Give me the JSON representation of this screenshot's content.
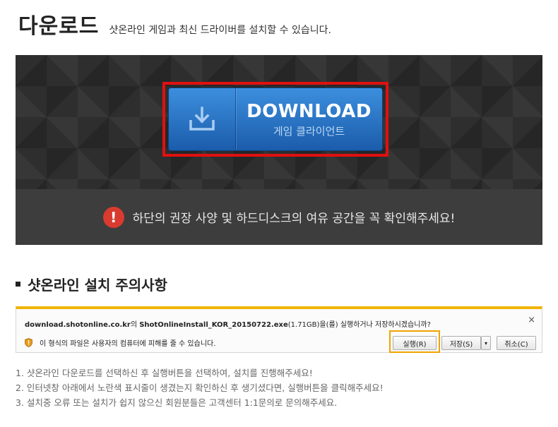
{
  "header": {
    "title": "다운로드",
    "subtitle": "샷온라인 게임과 최신 드라이버를 설치할 수 있습니다."
  },
  "download": {
    "label": "DOWNLOAD",
    "sublabel": "게임 클라이언트",
    "icon": "download-icon",
    "highlight_color": "#e01010",
    "button_color": "#2f7fd0"
  },
  "notice": {
    "icon": "exclamation-icon",
    "text": "하단의 권장 사양 및 하드디스크의 여유 공간을 꼭 확인해주세요!"
  },
  "section": {
    "title": "샷온라인 설치 주의사항"
  },
  "dialog": {
    "url": "download.shotonline.co.kr",
    "url_suffix": "의 ",
    "filename": "ShotOnlineInstall_KOR_20150722.exe",
    "size_text": "(1.71GB)을(를) 실행하거나 저장하시겠습니까?",
    "warning_text": "이 형식의 파일은 사용자의 컴퓨터에 피해를 줄 수 있습니다.",
    "run_label": "실행(R)",
    "save_label": "저장(S)",
    "save_dropdown": "▾",
    "cancel_label": "취소(C)",
    "close_glyph": "×",
    "accent_color": "#f0b400"
  },
  "steps": [
    "1. 샷온라인 다운로드를 선택하신 후 실행버튼을 선택하여, 설치를 진행해주세요!",
    "2. 인터넷창 아래에서 노란색 표시줄이 생겼는지 확인하신 후 생기셨다면, 실행버튼을 클릭해주세요!",
    "3. 설치중 오류 또는 설치가 쉽지 않으신 회원분들은 고객센터 1:1문의로 문의해주세요."
  ]
}
